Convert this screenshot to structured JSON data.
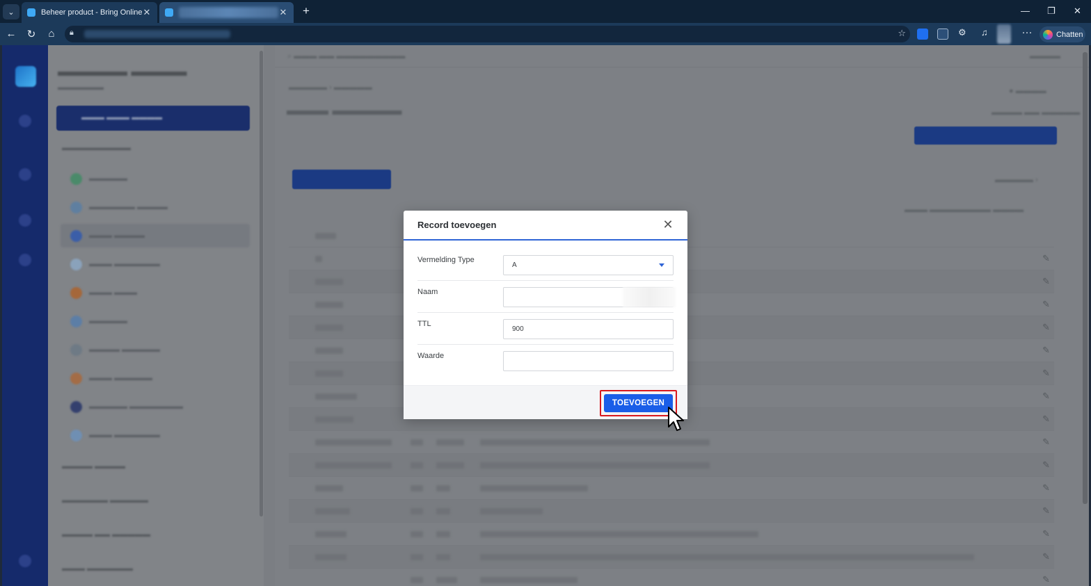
{
  "browser": {
    "tabs": [
      {
        "title": "Beheer product - Bring Online",
        "close": "✕"
      },
      {
        "title": "",
        "close": "✕"
      }
    ],
    "new_tab": "+",
    "window_controls": {
      "minimize": "—",
      "restore": "❐",
      "close": "✕"
    },
    "nav": {
      "back": "←",
      "reload": "↻",
      "home": "⌂"
    },
    "chat_button": "Chatten",
    "more": "···"
  },
  "modal": {
    "title": "Record toevoegen",
    "close": "✕",
    "fields": {
      "type_label": "Vermelding Type",
      "type_value": "A",
      "naam_label": "Naam",
      "naam_value": "",
      "ttl_label": "TTL",
      "ttl_value": "900",
      "waarde_label": "Waarde",
      "waarde_value": ""
    },
    "submit_label": "TOEVOEGEN"
  },
  "colors": {
    "accent": "#1a5ee8",
    "highlight": "#d8191f",
    "chrome": "#0f2236"
  }
}
